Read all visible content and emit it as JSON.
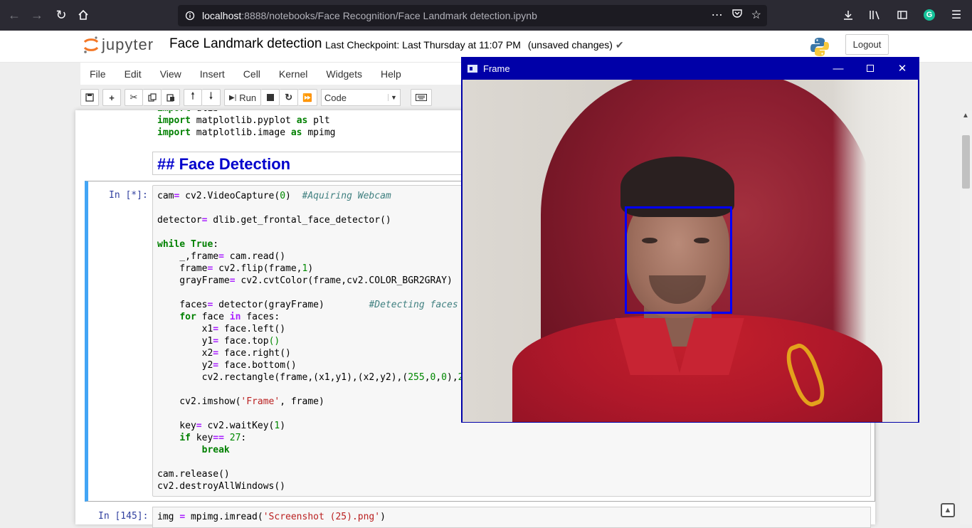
{
  "browser": {
    "url_host": "localhost",
    "url_rest": ":8888/notebooks/Face Recognition/Face Landmark detection.ipynb"
  },
  "header": {
    "logo_text": "jupyter",
    "notebook_title": "Face Landmark detection",
    "checkpoint": "Last Checkpoint: Last Thursday at 11:07 PM",
    "unsaved": "(unsaved changes)",
    "logout_label": "Logout"
  },
  "menu": [
    "File",
    "Edit",
    "View",
    "Insert",
    "Cell",
    "Kernel",
    "Widgets",
    "Help"
  ],
  "toolbar": {
    "run_label": "Run",
    "cell_type": "Code"
  },
  "cells": {
    "top_code": "import dlib\nimport matplotlib.pyplot as plt\nimport matplotlib.image as mpimg",
    "markdown": "## Face Detection",
    "selected_prompt": "In [*]:",
    "bottom_prompt": "In [145]:"
  },
  "cv_window": {
    "title": "Frame"
  },
  "colors": {
    "browser_bg": "#2b2a33",
    "cv_title_bg": "#0000a8",
    "selected_border": "#42a5f5",
    "markdown_heading": "#0000cc",
    "face_box": "#0000ff"
  }
}
